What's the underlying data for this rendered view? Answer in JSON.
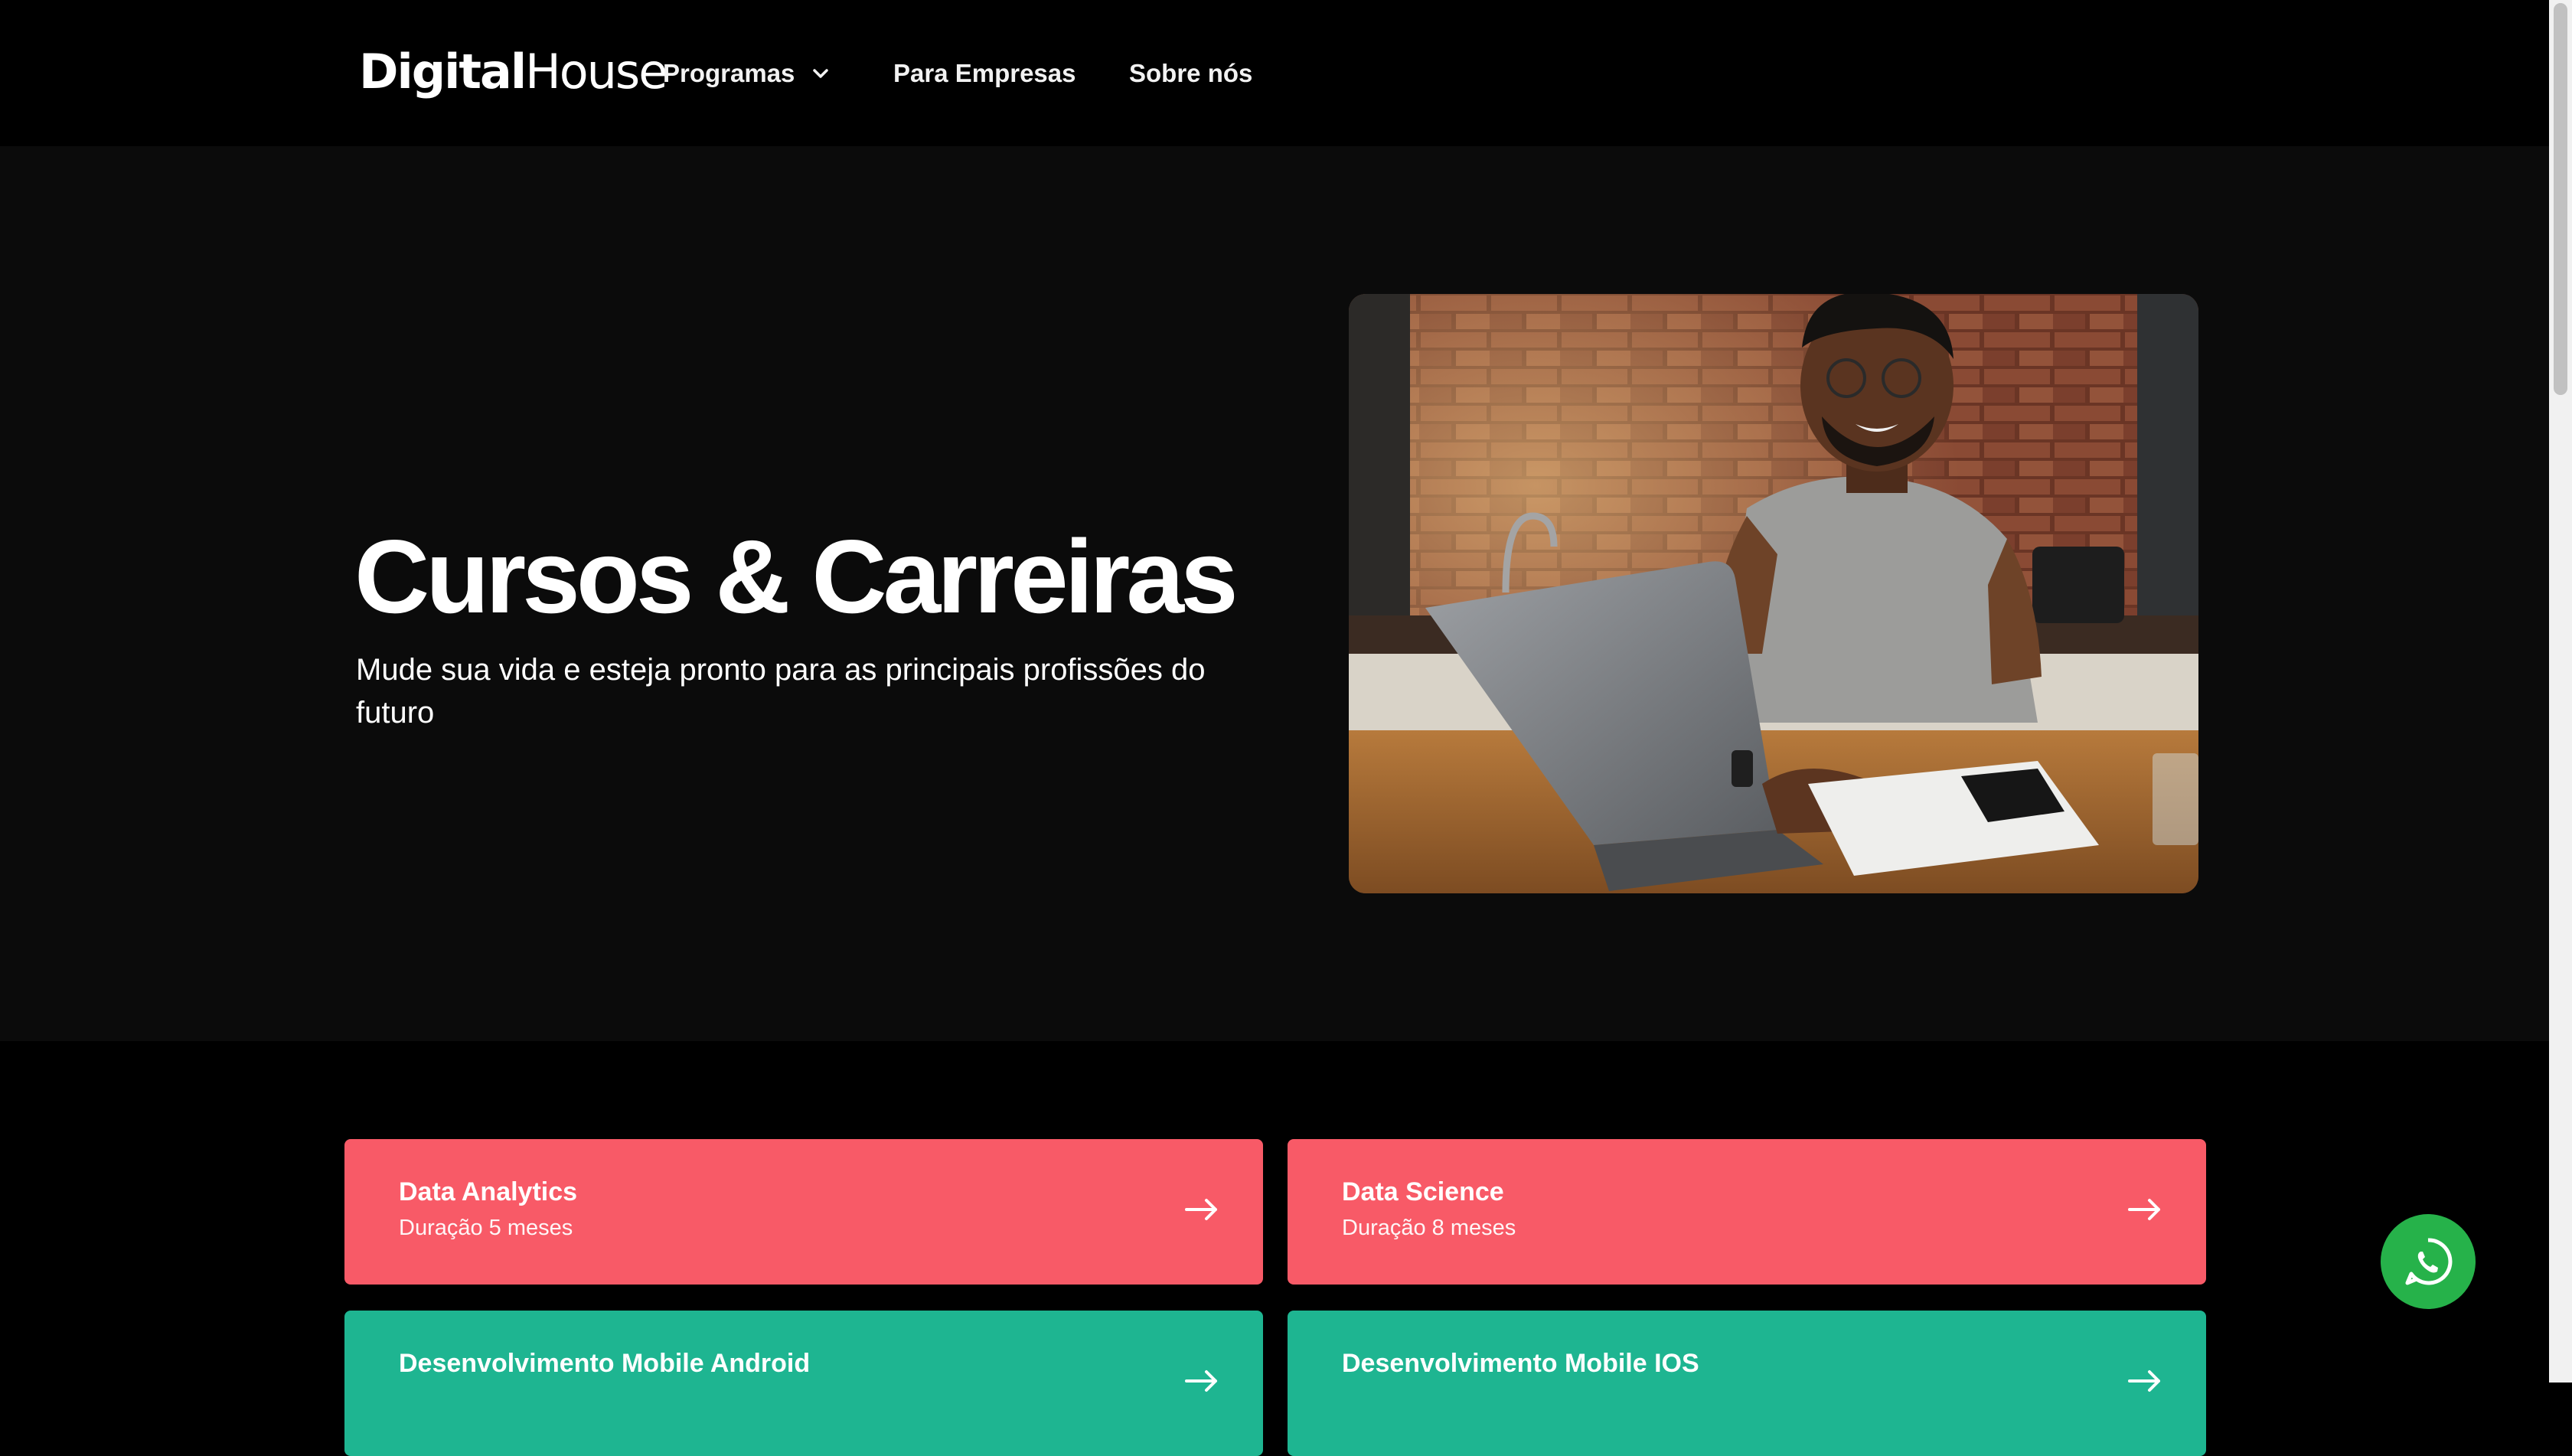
{
  "header": {
    "logo_bold": "Digital",
    "logo_light": "House",
    "nav": [
      {
        "label": "Programas"
      },
      {
        "label": "Para Empresas"
      },
      {
        "label": "Sobre nós"
      }
    ]
  },
  "hero": {
    "title": "Cursos & Carreiras",
    "subtitle": "Mude sua vida e esteja pronto para as principais profissões do futuro",
    "image": "photo-man-laptop"
  },
  "courses": [
    {
      "title": "Data Analytics",
      "duration": "Duração 5 meses",
      "color": "#f85a67"
    },
    {
      "title": "Data Science",
      "duration": "Duração 8 meses",
      "color": "#f85a67"
    },
    {
      "title": "Desenvolvimento Mobile Android",
      "duration": "",
      "color": "#1eb591"
    },
    {
      "title": "Desenvolvimento Mobile IOS",
      "duration": "",
      "color": "#1eb591"
    }
  ],
  "colors": {
    "background": "#000000",
    "hero_background": "#0b0b0b",
    "accent_red": "#f85a67",
    "accent_green": "#1eb591",
    "whatsapp_green": "#26b24a"
  },
  "icons": {
    "whatsapp": "whatsapp-icon",
    "arrow": "arrow-right-icon",
    "chevron": "chevron-down-icon"
  }
}
